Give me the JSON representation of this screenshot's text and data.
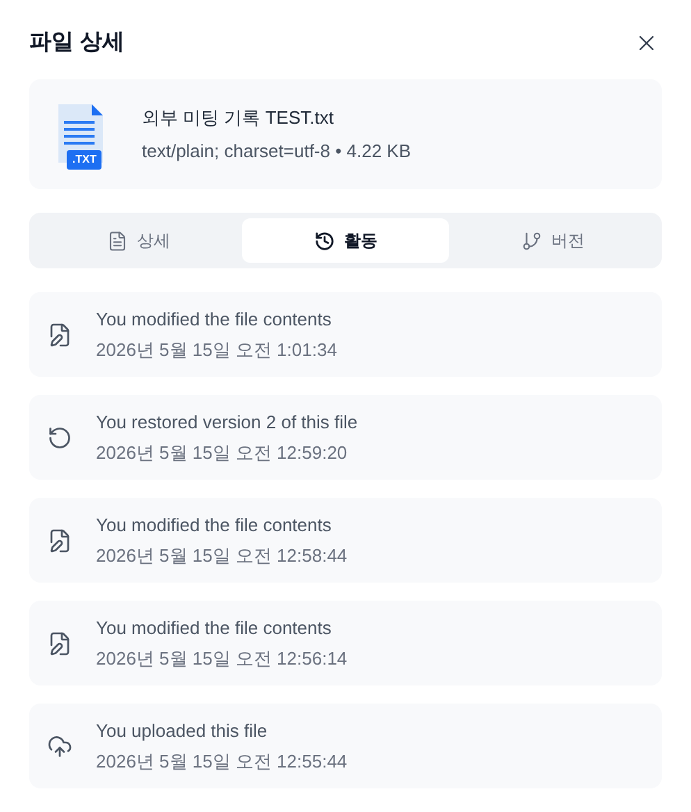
{
  "title": "파일 상세",
  "file": {
    "name": "외부 미팅 기록 TEST.txt",
    "badge": ".TXT",
    "meta": "text/plain; charset=utf-8 • 4.22 KB"
  },
  "tabs": [
    {
      "label": "상세",
      "kind": "details",
      "selected": false
    },
    {
      "label": "활동",
      "kind": "history",
      "selected": true
    },
    {
      "label": "버전",
      "kind": "versions",
      "selected": false
    }
  ],
  "activities": [
    {
      "kind": "modified",
      "text": "You modified the file contents",
      "time": "2026년 5월 15일 오전 1:01:34"
    },
    {
      "kind": "restored",
      "text": "You restored version 2 of this file",
      "time": "2026년 5월 15일 오전 12:59:20"
    },
    {
      "kind": "modified",
      "text": "You modified the file contents",
      "time": "2026년 5월 15일 오전 12:58:44"
    },
    {
      "kind": "modified",
      "text": "You modified the file contents",
      "time": "2026년 5월 15일 오전 12:56:14"
    },
    {
      "kind": "uploaded",
      "text": "You uploaded this file",
      "time": "2026년 5월 15일 오전 12:55:44"
    }
  ]
}
